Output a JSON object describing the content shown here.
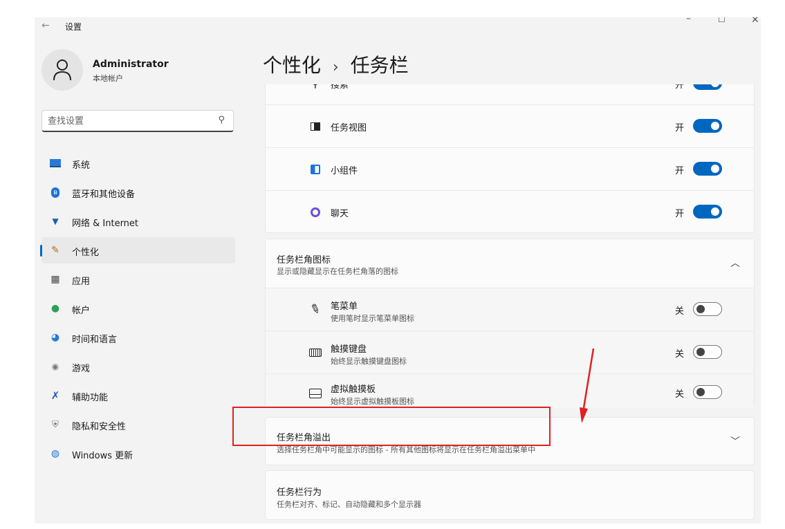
{
  "window": {
    "app_title": "设置",
    "back_icon": "arrow-left-icon",
    "controls": [
      "minimize-icon",
      "maximize-icon",
      "close-icon"
    ]
  },
  "profile": {
    "name": "Administrator",
    "account_type": "本地帐户"
  },
  "search": {
    "placeholder": "查找设置"
  },
  "sidebar": {
    "items": [
      {
        "label": "系统",
        "icon": "monitor-icon",
        "selected": false
      },
      {
        "label": "蓝牙和其他设备",
        "icon": "bluetooth-icon",
        "selected": false
      },
      {
        "label": "网络 & Internet",
        "icon": "wifi-icon",
        "selected": false
      },
      {
        "label": "个性化",
        "icon": "brush-icon",
        "selected": true
      },
      {
        "label": "应用",
        "icon": "apps-icon",
        "selected": false
      },
      {
        "label": "帐户",
        "icon": "person-icon",
        "selected": false
      },
      {
        "label": "时间和语言",
        "icon": "globe-clock-icon",
        "selected": false
      },
      {
        "label": "游戏",
        "icon": "gamepad-icon",
        "selected": false
      },
      {
        "label": "辅助功能",
        "icon": "accessibility-icon",
        "selected": false
      },
      {
        "label": "隐私和安全性",
        "icon": "shield-icon",
        "selected": false
      },
      {
        "label": "Windows 更新",
        "icon": "update-icon",
        "selected": false
      }
    ]
  },
  "breadcrumb": {
    "parent": "个性化",
    "separator": "›",
    "current": "任务栏"
  },
  "taskbar_items": [
    {
      "label": "搜索",
      "state": "开",
      "on": true,
      "icon": "search-icon"
    },
    {
      "label": "任务视图",
      "state": "开",
      "on": true,
      "icon": "task-view-icon"
    },
    {
      "label": "小组件",
      "state": "开",
      "on": true,
      "icon": "widgets-icon"
    },
    {
      "label": "聊天",
      "state": "开",
      "on": true,
      "icon": "chat-icon"
    }
  ],
  "corner_icons": {
    "title": "任务栏角图标",
    "subtitle": "显示或隐藏显示在任务栏角落的图标",
    "items": [
      {
        "label": "笔菜单",
        "sub": "使用笔时显示笔菜单图标",
        "state": "关",
        "on": false,
        "icon": "pen-icon"
      },
      {
        "label": "触摸键盘",
        "sub": "始终显示触摸键盘图标",
        "state": "关",
        "on": false,
        "icon": "keyboard-icon"
      },
      {
        "label": "虚拟触摸板",
        "sub": "始终显示虚拟触摸板图标",
        "state": "关",
        "on": false,
        "icon": "touchpad-icon"
      }
    ]
  },
  "corner_overflow": {
    "title": "任务栏角溢出",
    "subtitle": "选择任务栏角中可能显示的图标 - 所有其他图标将显示在任务栏角溢出菜单中"
  },
  "behaviors": {
    "title": "任务栏行为",
    "subtitle": "任务栏对齐、标记、自动隐藏和多个显示器"
  },
  "colors": {
    "accent": "#0067c0",
    "annotation": "#e02020"
  }
}
